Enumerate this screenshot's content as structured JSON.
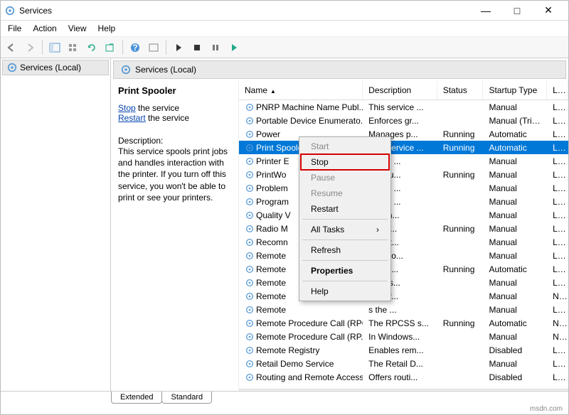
{
  "titlebar": {
    "title": "Services"
  },
  "menu": {
    "file": "File",
    "action": "Action",
    "view": "View",
    "help": "Help"
  },
  "leftpane": {
    "label": "Services (Local)"
  },
  "rp_header": {
    "label": "Services (Local)"
  },
  "detail": {
    "title": "Print Spooler",
    "stop_label": "Stop",
    "stop_suffix": " the service",
    "restart_label": "Restart",
    "restart_suffix": " the service",
    "desc_heading": "Description:",
    "desc_text": "This service spools print jobs and handles interaction with the printer. If you turn off this service, you won't be able to print or see your printers."
  },
  "columns": {
    "name": "Name",
    "desc": "Description",
    "status": "Status",
    "startup": "Startup Type",
    "logon": "Log On As"
  },
  "services": [
    {
      "name": "PNRP Machine Name Publ...",
      "desc": "This service ...",
      "status": "",
      "startup": "Manual",
      "logon": "Loca"
    },
    {
      "name": "Portable Device Enumerato...",
      "desc": "Enforces gr...",
      "status": "",
      "startup": "Manual (Trig...",
      "logon": "Loca"
    },
    {
      "name": "Power",
      "desc": "Manages p...",
      "status": "Running",
      "startup": "Automatic",
      "logon": "Loca"
    },
    {
      "name": "Print Spooler",
      "desc": "This service ...",
      "status": "Running",
      "startup": "Automatic",
      "logon": "Loca",
      "selected": true
    },
    {
      "name": "Printer E",
      "desc": "ervice ...",
      "status": "",
      "startup": "Manual",
      "logon": "Loca"
    },
    {
      "name": "PrintWo",
      "desc": "des su...",
      "status": "Running",
      "startup": "Manual",
      "logon": "Loca"
    },
    {
      "name": "Problem",
      "desc": "ervice ...",
      "status": "",
      "startup": "Manual",
      "logon": "Loca"
    },
    {
      "name": "Program",
      "desc": "ervice ...",
      "status": "",
      "startup": "Manual",
      "logon": "Loca"
    },
    {
      "name": "Quality V",
      "desc": "ty Win...",
      "status": "",
      "startup": "Manual",
      "logon": "Loca"
    },
    {
      "name": "Radio M",
      "desc": "Mana...",
      "status": "Running",
      "startup": "Manual",
      "logon": "Loca"
    },
    {
      "name": "Recomn",
      "desc": "es aut...",
      "status": "",
      "startup": "Manual",
      "logon": "Loca"
    },
    {
      "name": "Remote",
      "desc": "es a co...",
      "status": "",
      "startup": "Manual",
      "logon": "Loca"
    },
    {
      "name": "Remote",
      "desc": "ges di...",
      "status": "Running",
      "startup": "Automatic",
      "logon": "Loca"
    },
    {
      "name": "Remote",
      "desc": "te Des...",
      "status": "",
      "startup": "Manual",
      "logon": "Loca"
    },
    {
      "name": "Remote",
      "desc": "s user...",
      "status": "",
      "startup": "Manual",
      "logon": "Netv"
    },
    {
      "name": "Remote",
      "desc": "s the ...",
      "status": "",
      "startup": "Manual",
      "logon": "Loca"
    },
    {
      "name": "Remote Procedure Call (RPC)",
      "desc": "The RPCSS s...",
      "status": "Running",
      "startup": "Automatic",
      "logon": "Netv"
    },
    {
      "name": "Remote Procedure Call (RP...",
      "desc": "In Windows...",
      "status": "",
      "startup": "Manual",
      "logon": "Netv"
    },
    {
      "name": "Remote Registry",
      "desc": "Enables rem...",
      "status": "",
      "startup": "Disabled",
      "logon": "Loca"
    },
    {
      "name": "Retail Demo Service",
      "desc": "The Retail D...",
      "status": "",
      "startup": "Manual",
      "logon": "Loca"
    },
    {
      "name": "Routing and Remote Access",
      "desc": "Offers routi...",
      "status": "",
      "startup": "Disabled",
      "logon": "Loca"
    }
  ],
  "context_menu": {
    "start": "Start",
    "stop": "Stop",
    "pause": "Pause",
    "resume": "Resume",
    "restart": "Restart",
    "all_tasks": "All Tasks",
    "refresh": "Refresh",
    "properties": "Properties",
    "help": "Help"
  },
  "tabs": {
    "extended": "Extended",
    "standard": "Standard"
  },
  "footer": {
    "brand": "msdn.com"
  }
}
